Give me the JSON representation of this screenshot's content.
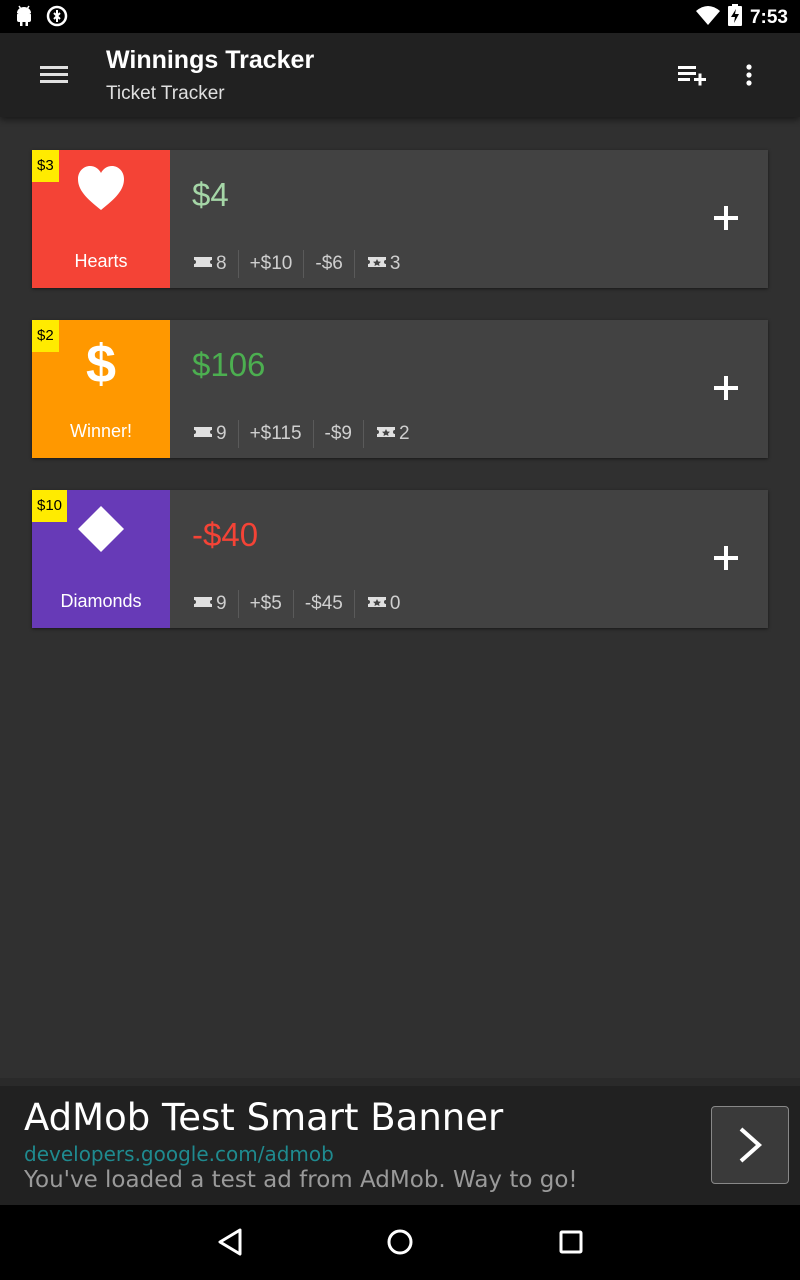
{
  "status_bar": {
    "time": "7:53",
    "icons_left": [
      "android-icon",
      "sync-icon"
    ],
    "icons_right": [
      "wifi-icon",
      "battery-charging-icon"
    ]
  },
  "app_bar": {
    "title": "Winnings Tracker",
    "subtitle": "Ticket Tracker",
    "icons": [
      "menu-icon",
      "playlist-add-icon",
      "overflow-menu-icon"
    ]
  },
  "cards": [
    {
      "price": "$3",
      "name": "Hearts",
      "symbol": "heart",
      "tile_color": "#f44336",
      "amount": "$4",
      "amount_color": "#a5d6a7",
      "tickets": "8",
      "gains": "+$10",
      "losses": "-$6",
      "winners": "3"
    },
    {
      "price": "$2",
      "name": "Winner!",
      "symbol": "dollar",
      "tile_color": "#ff9800",
      "amount": "$106",
      "amount_color": "#4caf50",
      "tickets": "9",
      "gains": "+$115",
      "losses": "-$9",
      "winners": "2"
    },
    {
      "price": "$10",
      "name": "Diamonds",
      "symbol": "diamond",
      "tile_color": "#673ab7",
      "amount": "-$40",
      "amount_color": "#f44336",
      "tickets": "9",
      "gains": "+$5",
      "losses": "-$45",
      "winners": "0"
    }
  ],
  "ad": {
    "title": "AdMob Test Smart Banner",
    "url": "developers.google.com/admob",
    "body": "You've loaded a test ad from AdMob. Way to go!"
  },
  "nav_bar": {
    "icons": [
      "back-icon",
      "home-icon",
      "recents-icon"
    ]
  }
}
